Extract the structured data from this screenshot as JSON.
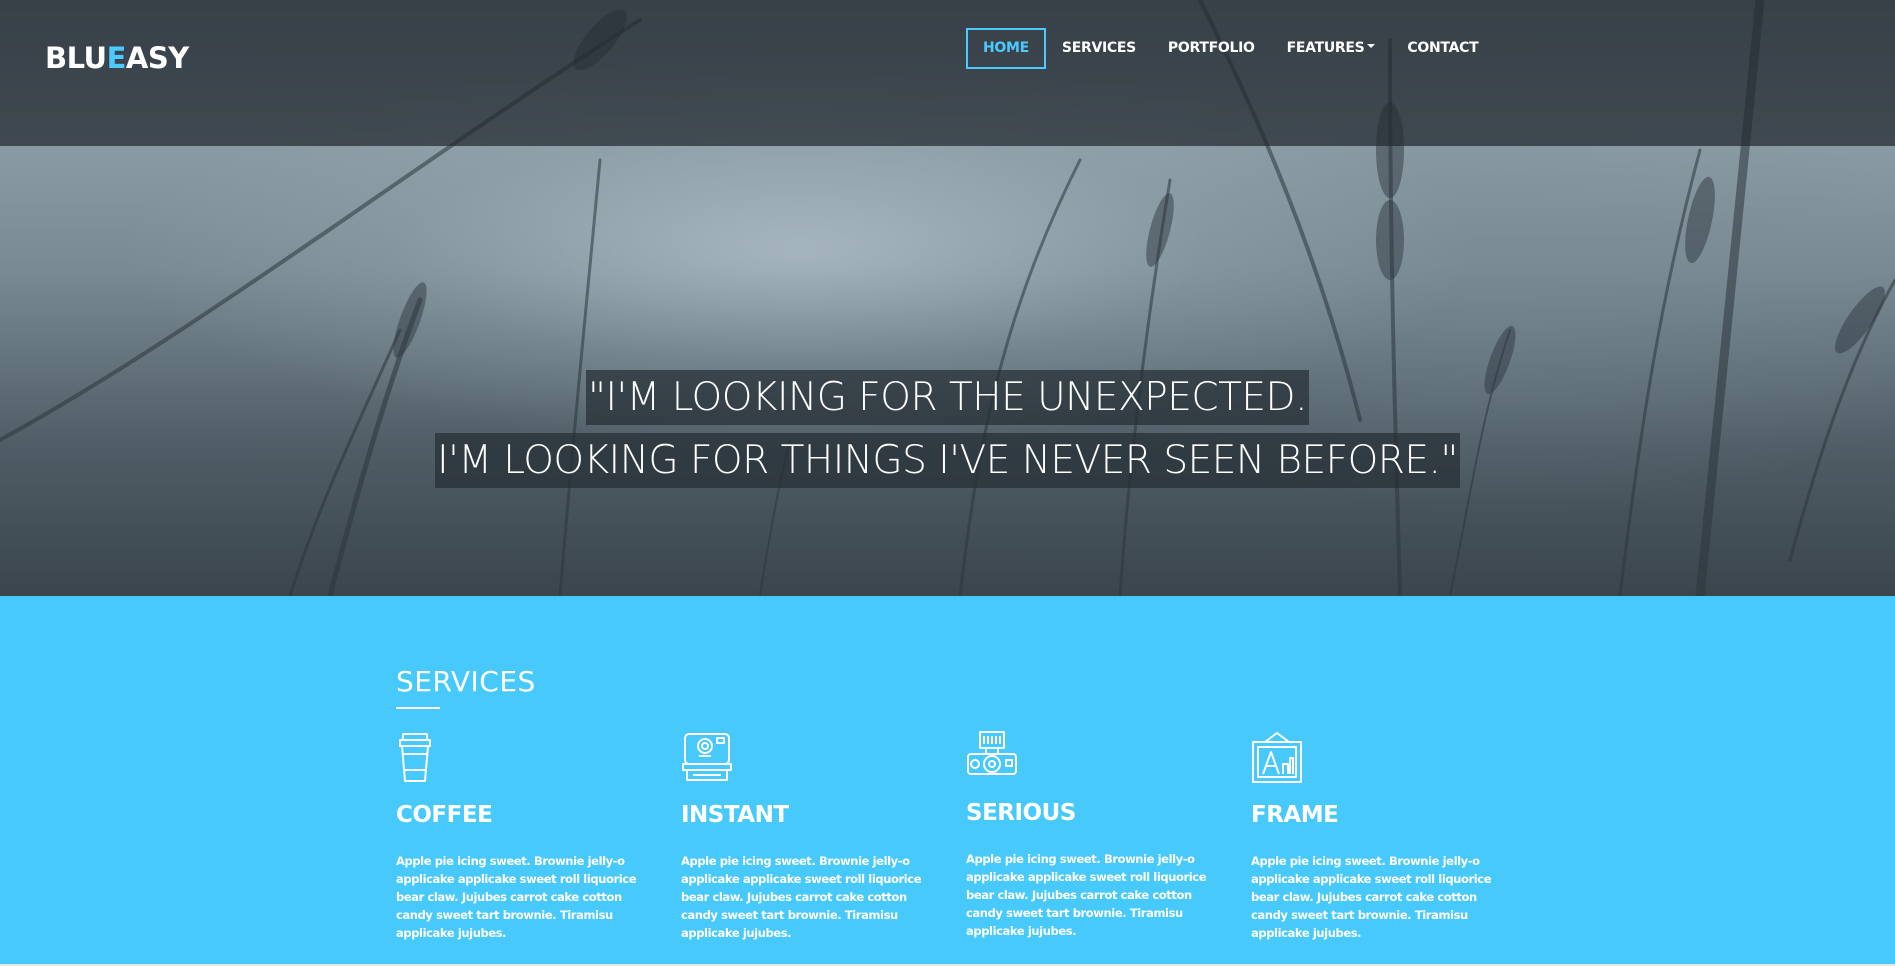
{
  "brand": {
    "logo_part1": "BLU",
    "logo_accent": "E",
    "logo_part2": "ASY",
    "accent_color": "#4ccaff"
  },
  "nav": {
    "items": [
      {
        "label": "HOME",
        "active": true
      },
      {
        "label": "SERVICES",
        "active": false
      },
      {
        "label": "PORTFOLIO",
        "active": false
      },
      {
        "label": "FEATURES",
        "active": false,
        "dropdown": true
      },
      {
        "label": "CONTACT",
        "active": false
      }
    ]
  },
  "hero": {
    "quote_line1": "\"I'M LOOKING FOR THE UNEXPECTED.",
    "quote_line2": "I'M LOOKING FOR THINGS I'VE NEVER SEEN BEFORE.\""
  },
  "services": {
    "title": "SERVICES",
    "background_color": "#48c9fb",
    "items": [
      {
        "icon": "coffee-cup-icon",
        "name": "COFFEE",
        "description": "Apple pie icing sweet. Brownie jelly-o applicake applicake sweet roll liquorice bear claw. Jujubes carrot cake cotton candy sweet tart brownie. Tiramisu applicake jujubes."
      },
      {
        "icon": "instant-camera-icon",
        "name": "INSTANT",
        "description": "Apple pie icing sweet. Brownie jelly-o applicake applicake sweet roll liquorice bear claw. Jujubes carrot cake cotton candy sweet tart brownie. Tiramisu applicake jujubes."
      },
      {
        "icon": "vintage-camera-icon",
        "name": "SERIOUS",
        "description": "Apple pie icing sweet. Brownie jelly-o applicake applicake sweet roll liquorice bear claw. Jujubes carrot cake cotton candy sweet tart brownie. Tiramisu applicake jujubes."
      },
      {
        "icon": "picture-frame-icon",
        "name": "FRAME",
        "description": "Apple pie icing sweet. Brownie jelly-o applicake applicake sweet roll liquorice bear claw. Jujubes carrot cake cotton candy sweet tart brownie. Tiramisu applicake jujubes."
      }
    ]
  }
}
